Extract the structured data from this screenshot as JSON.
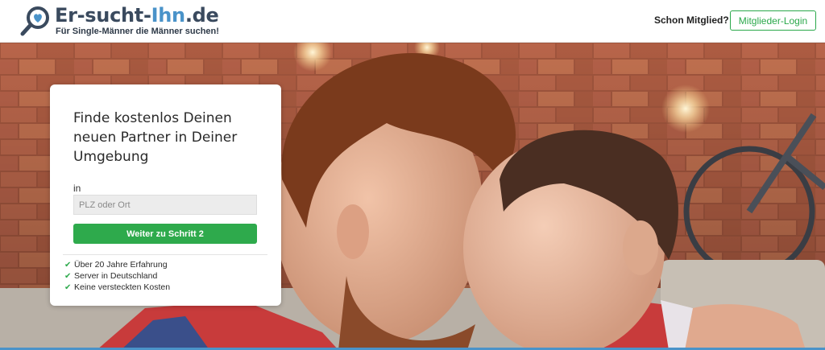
{
  "header": {
    "logo": {
      "title_part1": "Er-sucht-",
      "title_part2": "Ihn",
      "title_part3": ".de",
      "tagline": "Für Single-Männer die Männer suchen!",
      "icon": "magnifier-heart-icon"
    },
    "member_question": "Schon Mitglied?",
    "login_label": "Mitglieder-Login"
  },
  "card": {
    "title": "Finde kostenlos Deinen neuen Partner in Deiner Umgebung",
    "location_label": "in",
    "location_placeholder": "PLZ oder Ort",
    "location_value": "",
    "submit_label": "Weiter zu Schritt 2",
    "features": [
      "Über 20 Jahre Erfahrung",
      "Server in Deutschland",
      "Keine versteckten Kosten"
    ]
  },
  "colors": {
    "brand_dark": "#3a4a5e",
    "brand_blue": "#4a93c9",
    "accent_green": "#2eaa4c"
  }
}
